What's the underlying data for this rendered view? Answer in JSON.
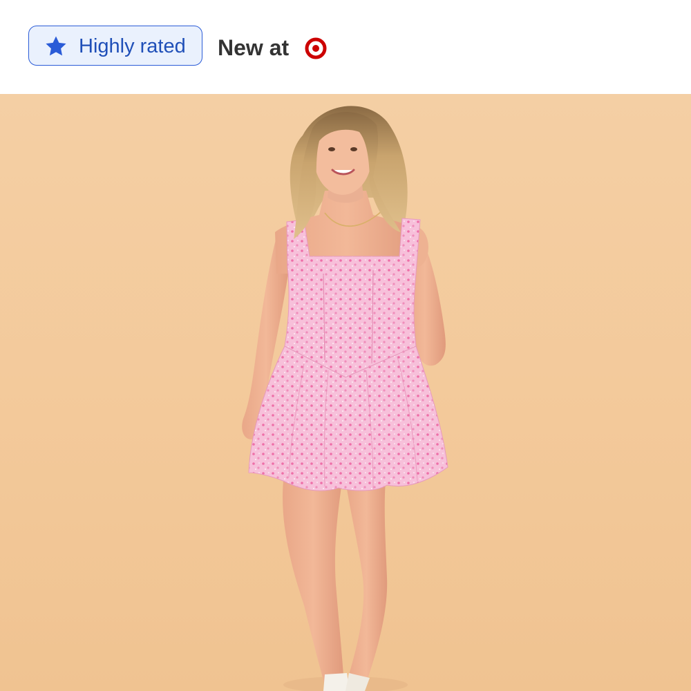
{
  "header": {
    "badge": {
      "label": "Highly rated",
      "icon": "star-icon",
      "accent": "#2a5bd7"
    },
    "new_at_label": "New at",
    "store_logo": {
      "icon": "target-bullseye-icon",
      "color": "#cc0000"
    }
  },
  "product_image": {
    "background_color": "#f3c99a",
    "dress_color": "#f6b7d3"
  }
}
